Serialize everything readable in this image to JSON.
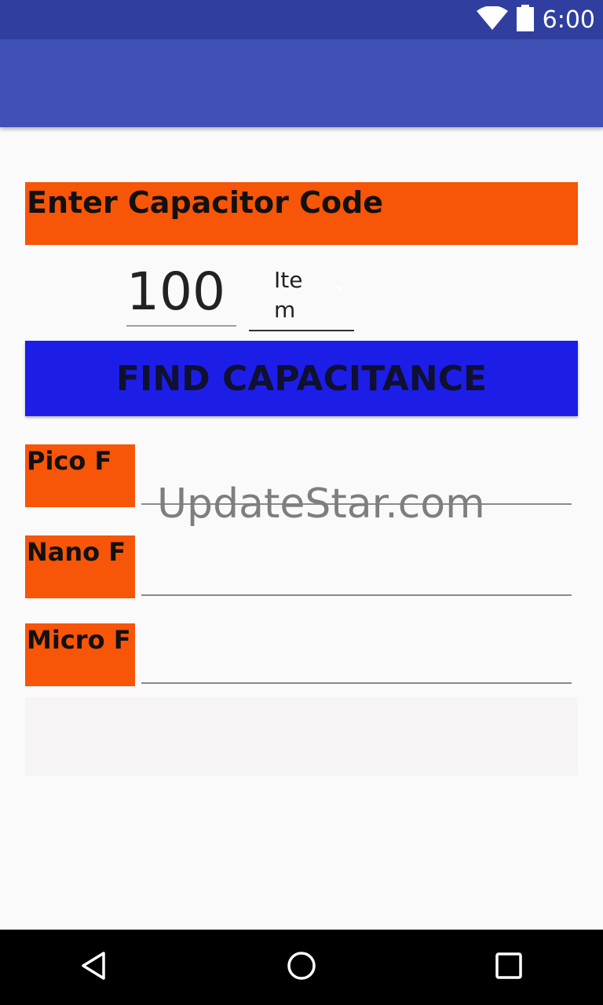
{
  "status_bar": {
    "time": "6:00",
    "icons": [
      "wifi-icon",
      "battery-icon"
    ],
    "color": "#303f9f"
  },
  "app_bar": {
    "title": "",
    "color": "#3f51b5"
  },
  "form": {
    "header_label": "Enter Capacitor Code",
    "code_value": "100",
    "spinner_value": "Item",
    "find_button_label": "FIND CAPACITANCE",
    "accent_color": "#f75508",
    "button_color": "#1c1ee8"
  },
  "results": [
    {
      "label": "Pico F",
      "value": ""
    },
    {
      "label": "Nano F",
      "value": ""
    },
    {
      "label": "Micro F",
      "value": ""
    }
  ],
  "watermark": "UpdateStar.com",
  "nav_bar": {
    "icons": [
      "back-icon",
      "home-icon",
      "recents-icon"
    ]
  }
}
